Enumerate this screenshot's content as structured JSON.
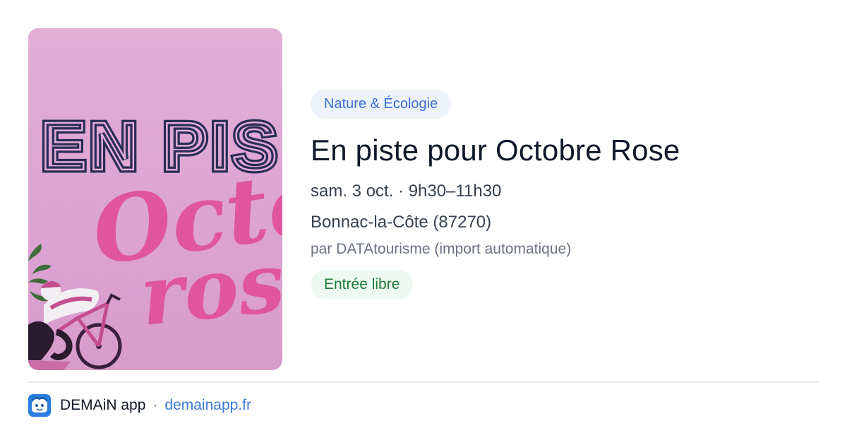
{
  "event": {
    "poster": {
      "headline": "EN PIS",
      "script_line1": "Octo",
      "script_line2": "ros"
    },
    "category": "Nature & Écologie",
    "title": "En piste pour Octobre Rose",
    "datetime": "sam. 3 oct. · 9h30–11h30",
    "location": "Bonnac-la-Côte (87270)",
    "source": "par DATAtourisme (import automatique)",
    "price": "Entrée libre"
  },
  "footer": {
    "app_name": "DEMAiN app",
    "separator": "·",
    "link": "demainapp.fr"
  },
  "colors": {
    "poster_bg": "#dca4d3",
    "poster_navy": "#2a2d55",
    "poster_pink": "#e0569e",
    "category_text": "#3b6fd0",
    "category_bg": "#eef3fb",
    "price_text": "#1f7a3c",
    "price_bg": "#eefaf1",
    "link": "#3b7bd4",
    "logo": "#2b7ee0"
  },
  "icons": {
    "app_logo": "app-logo-icon"
  }
}
